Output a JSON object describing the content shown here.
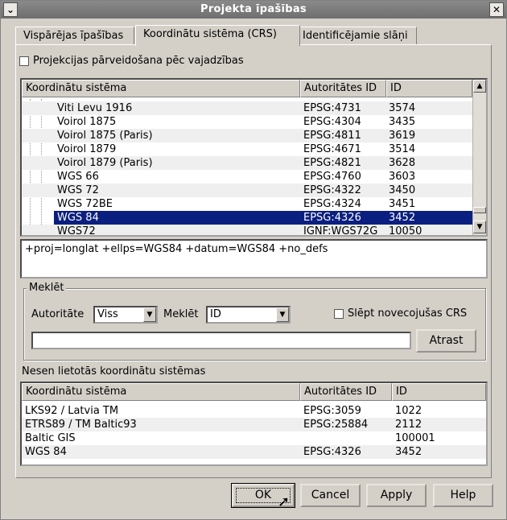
{
  "window": {
    "title": "Projekta īpašības",
    "menu_icon": "chevron-down-icon",
    "close_icon": "close-icon"
  },
  "tabs": [
    {
      "label": "Vispārējas īpašības"
    },
    {
      "label": "Koordinātu sistēma (CRS)"
    },
    {
      "label": "Identificējamie slāņi"
    }
  ],
  "otf": {
    "label": "Projekcijas pārveidošana pēc vajadzības",
    "checked": false
  },
  "crs_list": {
    "headers": [
      "Koordinātu sistēma",
      "Autoritātes ID",
      "ID"
    ],
    "rows": [
      {
        "name": "Viti Levu 1916",
        "auth": "EPSG:4731",
        "id": "3574"
      },
      {
        "name": "Voirol 1875",
        "auth": "EPSG:4304",
        "id": "3435"
      },
      {
        "name": "Voirol 1875 (Paris)",
        "auth": "EPSG:4811",
        "id": "3619"
      },
      {
        "name": "Voirol 1879",
        "auth": "EPSG:4671",
        "id": "3514"
      },
      {
        "name": "Voirol 1879 (Paris)",
        "auth": "EPSG:4821",
        "id": "3628"
      },
      {
        "name": "WGS 66",
        "auth": "EPSG:4760",
        "id": "3603"
      },
      {
        "name": "WGS 72",
        "auth": "EPSG:4322",
        "id": "3450"
      },
      {
        "name": "WGS 72BE",
        "auth": "EPSG:4324",
        "id": "3451"
      },
      {
        "name": "WGS 84",
        "auth": "EPSG:4326",
        "id": "3452"
      },
      {
        "name": "WGS72",
        "auth": "IGNF:WGS72G",
        "id": "10050"
      }
    ],
    "selected_index": 8
  },
  "proj_string": "+proj=longlat +ellps=WGS84 +datum=WGS84 +no_defs",
  "search": {
    "group_label": "Meklēt",
    "authority_label": "Autoritāte",
    "authority_value": "Viss",
    "search_label": "Meklēt",
    "search_value": "ID",
    "hide_deprecated_label": "Slēpt novecojušas CRS",
    "hide_deprecated_checked": false,
    "query_value": "",
    "find_button": "Atrast"
  },
  "recent": {
    "label": "Nesen lietotās koordinātu sistēmas",
    "headers": [
      "Koordinātu sistēma",
      "Autoritātes ID",
      "ID"
    ],
    "rows": [
      {
        "name": "LKS92 / Latvia TM",
        "auth": "EPSG:3059",
        "id": "1022"
      },
      {
        "name": "ETRS89 / TM Baltic93",
        "auth": "EPSG:25884",
        "id": "2112"
      },
      {
        "name": "Baltic GIS",
        "auth": "",
        "id": "100001"
      },
      {
        "name": "WGS 84",
        "auth": "EPSG:4326",
        "id": "3452"
      }
    ]
  },
  "buttons": {
    "ok": "OK",
    "cancel": "Cancel",
    "apply": "Apply",
    "help": "Help"
  },
  "colors": {
    "selection": "#0a1f7f",
    "titlebar": "#7a7a7a"
  }
}
